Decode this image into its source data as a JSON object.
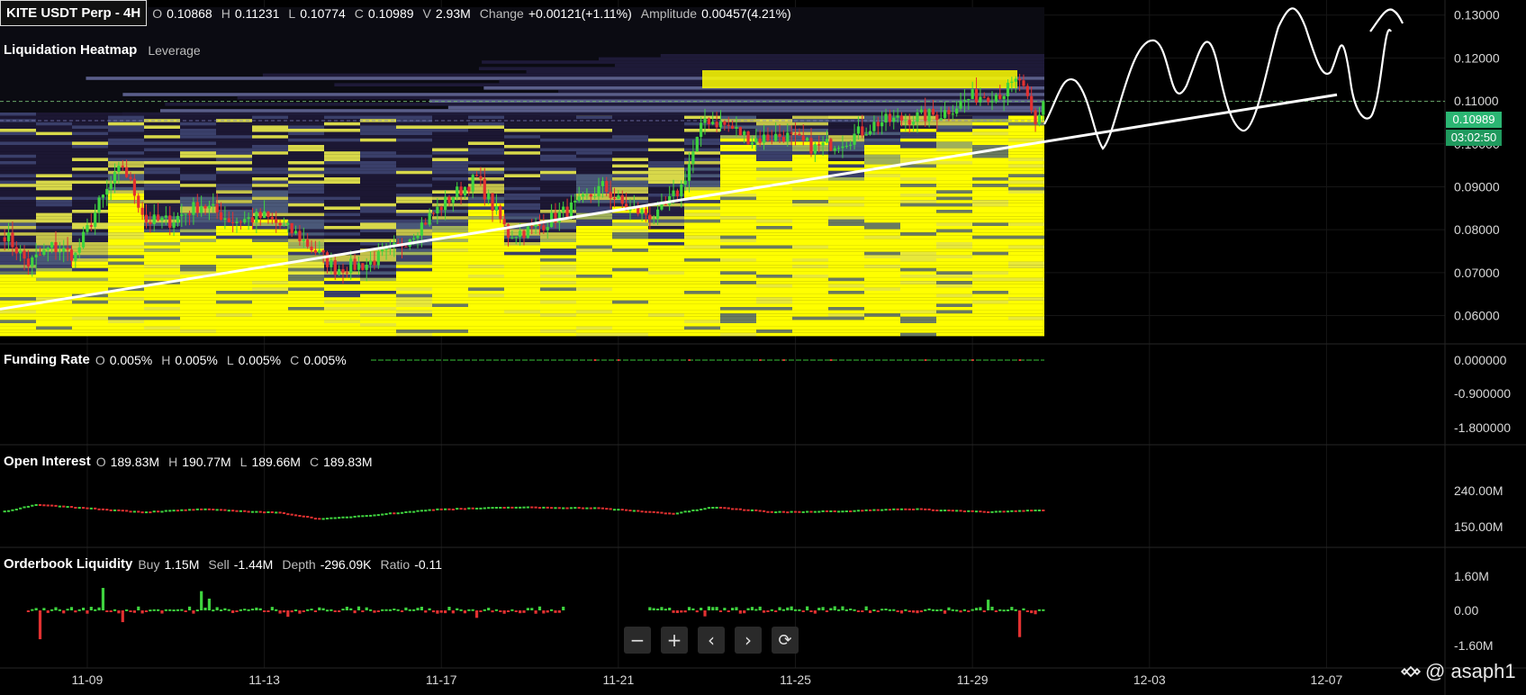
{
  "main_header": {
    "title": "KITE USDT Perp - 4H",
    "fields": [
      {
        "k": "O",
        "v": "0.10868"
      },
      {
        "k": "H",
        "v": "0.11231"
      },
      {
        "k": "L",
        "v": "0.10774"
      },
      {
        "k": "C",
        "v": "0.10989"
      },
      {
        "k": "V",
        "v": "2.93M"
      },
      {
        "k": "Change",
        "v": "+0.00121(+1.11%)"
      },
      {
        "k": "Amplitude",
        "v": "0.00457(4.21%)"
      }
    ],
    "indicator": "Liquidation Heatmap",
    "indicator_sub": "Leverage"
  },
  "last_price": {
    "value": "0.10989",
    "countdown": "03:02:50"
  },
  "funding_header": {
    "title": "Funding Rate",
    "fields": [
      {
        "k": "O",
        "v": "0.005%"
      },
      {
        "k": "H",
        "v": "0.005%"
      },
      {
        "k": "L",
        "v": "0.005%"
      },
      {
        "k": "C",
        "v": "0.005%"
      }
    ]
  },
  "oi_header": {
    "title": "Open Interest",
    "fields": [
      {
        "k": "O",
        "v": "189.83M"
      },
      {
        "k": "H",
        "v": "190.77M"
      },
      {
        "k": "L",
        "v": "189.66M"
      },
      {
        "k": "C",
        "v": "189.83M"
      }
    ]
  },
  "ob_header": {
    "title": "Orderbook Liquidity",
    "fields": [
      {
        "k": "Buy",
        "v": "1.15M"
      },
      {
        "k": "Sell",
        "v": "-1.44M"
      },
      {
        "k": "Depth",
        "v": "-296.09K"
      },
      {
        "k": "Ratio",
        "v": "-0.11"
      }
    ]
  },
  "buttons": {
    "zoom_out": "−",
    "zoom_in": "+",
    "prev": "‹",
    "next": "›",
    "reset": "⟳"
  },
  "watermark": "@ asaph1",
  "colors": {
    "up": "#3fd43f",
    "down": "#e23131",
    "heat_high": "#ffff00",
    "heat_low": "#2a2450",
    "price_tag": "#2bb673"
  },
  "chart_data": [
    {
      "type": "candlestick",
      "title": "KITE USDT Perp - 4H",
      "y_ticks": [
        "0.13000",
        "0.12000",
        "0.11000",
        "0.10000",
        "0.09000",
        "0.08000",
        "0.07000",
        "0.06000"
      ],
      "y_tick_values": [
        0.13,
        0.12,
        0.11,
        0.1,
        0.09,
        0.08,
        0.07,
        0.06
      ],
      "x_ticks": [
        "11-09",
        "11-13",
        "11-17",
        "11-21",
        "11-25",
        "11-29",
        "12-03",
        "12-07"
      ],
      "ylim": [
        0.0555,
        0.1335
      ],
      "last_close": 0.10989,
      "anchor_closes": [
        [
          0,
          0.079
        ],
        [
          6,
          0.072
        ],
        [
          12,
          0.076
        ],
        [
          18,
          0.074
        ],
        [
          24,
          0.086
        ],
        [
          30,
          0.095
        ],
        [
          36,
          0.082
        ],
        [
          42,
          0.082
        ],
        [
          50,
          0.086
        ],
        [
          58,
          0.082
        ],
        [
          66,
          0.083
        ],
        [
          74,
          0.079
        ],
        [
          84,
          0.071
        ],
        [
          92,
          0.072
        ],
        [
          100,
          0.076
        ],
        [
          108,
          0.083
        ],
        [
          114,
          0.088
        ],
        [
          120,
          0.092
        ],
        [
          128,
          0.079
        ],
        [
          134,
          0.08
        ],
        [
          140,
          0.083
        ],
        [
          146,
          0.086
        ],
        [
          152,
          0.09
        ],
        [
          158,
          0.085
        ],
        [
          166,
          0.083
        ],
        [
          172,
          0.09
        ],
        [
          178,
          0.106
        ],
        [
          184,
          0.104
        ],
        [
          190,
          0.101
        ],
        [
          198,
          0.102
        ],
        [
          206,
          0.099
        ],
        [
          214,
          0.101
        ],
        [
          222,
          0.105
        ],
        [
          230,
          0.106
        ],
        [
          238,
          0.107
        ],
        [
          246,
          0.111
        ],
        [
          254,
          0.112
        ],
        [
          258,
          0.115
        ],
        [
          262,
          0.104
        ],
        [
          264,
          0.109
        ]
      ],
      "support_line": [
        [
          0.0615,
          0
        ],
        [
          0.1005,
          264
        ]
      ],
      "liquidation_heatmap": "bands of leverage liquidation levels, dense (yellow) below price, sparse (purple) above"
    },
    {
      "type": "line",
      "title": "Funding Rate",
      "y_ticks": [
        "0.000000",
        "-0.900000",
        "-1.800000"
      ],
      "value": 0.005
    },
    {
      "type": "bar",
      "title": "Open Interest",
      "y_ticks": [
        "240.00M",
        "150.00M"
      ],
      "anchor_values_M": [
        [
          0,
          190
        ],
        [
          8,
          206
        ],
        [
          20,
          198
        ],
        [
          35,
          188
        ],
        [
          50,
          195
        ],
        [
          70,
          186
        ],
        [
          80,
          170
        ],
        [
          95,
          182
        ],
        [
          110,
          195
        ],
        [
          130,
          200
        ],
        [
          150,
          198
        ],
        [
          170,
          184
        ],
        [
          180,
          200
        ],
        [
          195,
          188
        ],
        [
          215,
          191
        ],
        [
          230,
          196
        ],
        [
          250,
          188
        ],
        [
          264,
          193
        ]
      ]
    },
    {
      "type": "bar",
      "title": "Orderbook Liquidity",
      "y_ticks": [
        "1.60M",
        "0.00",
        "-1.60M"
      ],
      "spikes_M": [
        [
          9,
          -1.35
        ],
        [
          25,
          1.05
        ],
        [
          30,
          -0.55
        ],
        [
          50,
          0.9
        ],
        [
          52,
          0.55
        ],
        [
          72,
          -0.3
        ],
        [
          120,
          -0.35
        ],
        [
          178,
          -0.28
        ],
        [
          250,
          0.5
        ],
        [
          258,
          -1.25
        ],
        [
          262,
          -0.18
        ]
      ]
    }
  ]
}
